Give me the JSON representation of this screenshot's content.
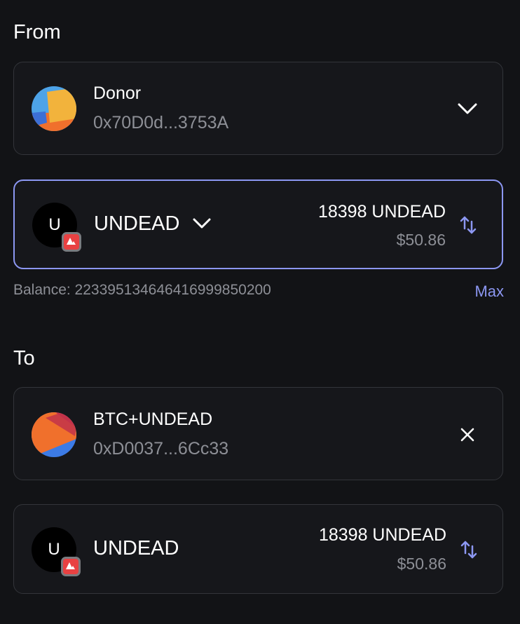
{
  "from": {
    "title": "From",
    "account": {
      "name": "Donor",
      "address": "0x70D0d...3753A",
      "icon": "chevron-down-icon"
    },
    "token": {
      "symbol_initial": "U",
      "symbol": "UNDEAD",
      "amount": "18398 UNDEAD",
      "fiat": "$50.86",
      "chain_icon": "avalanche-icon",
      "selector_icon": "chevron-down-icon",
      "toggle_icon": "swap-vertical-icon"
    },
    "balance": "Balance:  2233951346464169998502​00",
    "max_label": "Max"
  },
  "to": {
    "title": "To",
    "account": {
      "name": "BTC+UNDEAD",
      "address": "0xD0037...6Cc33",
      "icon": "close-icon"
    },
    "token": {
      "symbol_initial": "U",
      "symbol": "UNDEAD",
      "amount": "18398 UNDEAD",
      "fiat": "$50.86",
      "chain_icon": "avalanche-icon",
      "toggle_icon": "swap-vertical-icon"
    }
  },
  "colors": {
    "background": "#121316",
    "card_border": "#33353a",
    "accent": "#8c97f2",
    "muted_text": "#8d8f96",
    "avalanche_red": "#e84142"
  }
}
